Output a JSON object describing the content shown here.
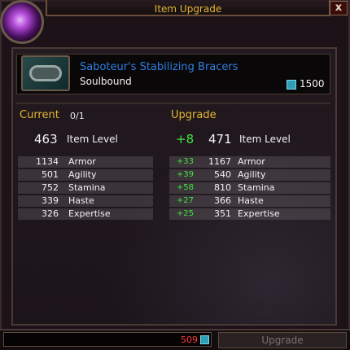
{
  "window": {
    "title": "Item Upgrade",
    "close_label": "x"
  },
  "item": {
    "name": "Saboteur's Stabilizing Bracers",
    "bind": "Soulbound",
    "cost": "1500",
    "icon": "bracers-icon"
  },
  "current": {
    "header": "Current",
    "progress": "0/1",
    "item_level": "463",
    "item_level_label": "Item Level",
    "stats": [
      {
        "value": "1134",
        "name": "Armor"
      },
      {
        "value": "501",
        "name": "Agility"
      },
      {
        "value": "752",
        "name": "Stamina"
      },
      {
        "value": "339",
        "name": "Haste"
      },
      {
        "value": "326",
        "name": "Expertise"
      }
    ]
  },
  "upgrade": {
    "header": "Upgrade",
    "item_level_delta": "+8",
    "item_level": "471",
    "item_level_label": "Item Level",
    "stats": [
      {
        "delta": "+33",
        "value": "1167",
        "name": "Armor"
      },
      {
        "delta": "+39",
        "value": "540",
        "name": "Agility"
      },
      {
        "delta": "+58",
        "value": "810",
        "name": "Stamina"
      },
      {
        "delta": "+27",
        "value": "366",
        "name": "Haste"
      },
      {
        "delta": "+25",
        "value": "351",
        "name": "Expertise"
      }
    ]
  },
  "footer": {
    "currency_amount": "509",
    "upgrade_button": "Upgrade"
  },
  "colors": {
    "gold": "#e3b52e",
    "item_blue": "#2e7fe0",
    "green": "#3fe33f",
    "red": "#ff3b3b"
  }
}
